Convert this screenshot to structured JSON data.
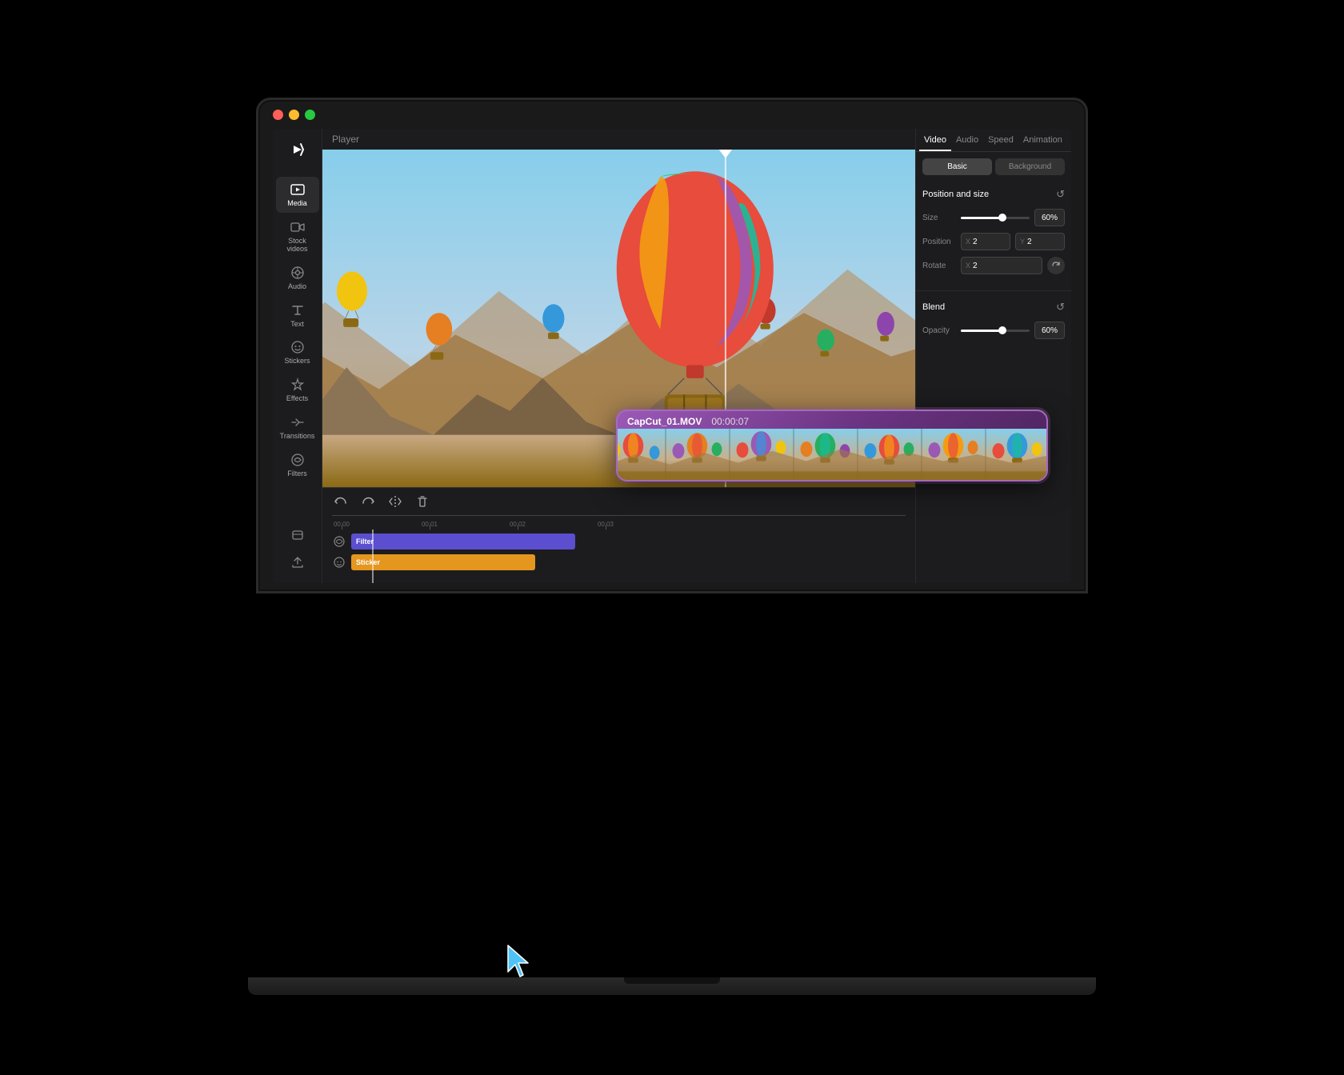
{
  "app": {
    "title": "CapCut",
    "logo_label": "CapCut logo"
  },
  "window": {
    "traffic_lights": {
      "red": "#ff5f57",
      "yellow": "#febc2e",
      "green": "#28c840"
    }
  },
  "sidebar": {
    "items": [
      {
        "id": "media",
        "label": "Media",
        "active": true
      },
      {
        "id": "stock-videos",
        "label": "Stock videos",
        "active": false
      },
      {
        "id": "audio",
        "label": "Audio",
        "active": false
      },
      {
        "id": "text",
        "label": "Text",
        "active": false
      },
      {
        "id": "stickers",
        "label": "Stickers",
        "active": false
      },
      {
        "id": "effects",
        "label": "Effects",
        "active": false
      },
      {
        "id": "transitions",
        "label": "Transitions",
        "active": false
      },
      {
        "id": "filters",
        "label": "Filters",
        "active": false
      }
    ]
  },
  "player": {
    "label": "Player"
  },
  "right_panel": {
    "tabs": [
      "Video",
      "Audio",
      "Speed",
      "Animation"
    ],
    "active_tab": "Video",
    "subtabs": [
      "Basic",
      "Background"
    ],
    "active_subtab": "Basic",
    "position_size": {
      "title": "Position and size",
      "size_label": "Size",
      "size_value": "60%",
      "position_label": "Position",
      "pos_x_label": "X",
      "pos_x_value": "2",
      "pos_y_label": "Y",
      "pos_y_value": "2",
      "rotate_label": "Rotate",
      "rotate_x_label": "X",
      "rotate_x_value": "2"
    },
    "blend": {
      "title": "Blend",
      "opacity_label": "Opacity",
      "opacity_value": "60%"
    }
  },
  "timeline": {
    "ruler_marks": [
      "00:00",
      "00:01",
      "00:02",
      "00:03"
    ],
    "tracks": [
      {
        "id": "filter",
        "label": "Filter",
        "color": "#5b4fcf"
      },
      {
        "id": "sticker",
        "label": "Sticker",
        "color": "#e5961e"
      }
    ],
    "buttons": [
      "undo",
      "redo",
      "split",
      "delete"
    ]
  },
  "floating_timeline": {
    "filename": "CapCut_01.MOV",
    "timecode": "00:00:07"
  },
  "colors": {
    "bg": "#1c1c1e",
    "sidebar_bg": "#1c1c1e",
    "panel_bg": "#1c1c1e",
    "accent_purple": "#5b4fcf",
    "accent_orange": "#e5961e",
    "floating_border": "#a569bd"
  }
}
